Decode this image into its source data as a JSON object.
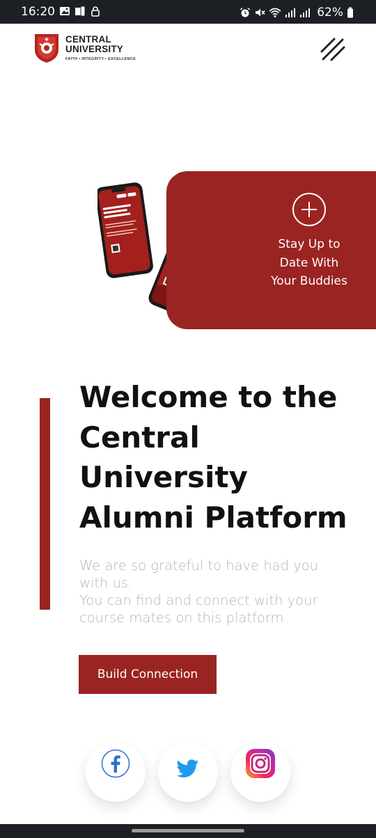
{
  "status_bar": {
    "time": "16:20",
    "battery": "62%"
  },
  "header": {
    "logo_name_line1": "CENTRAL",
    "logo_name_line2": "UNIVERSITY",
    "logo_motto": "FAITH • INTEGRITY • EXCELLENCE",
    "menu_icon": "menu-slashes-icon"
  },
  "hero": {
    "card_text": "Stay Up to Date With Your Buddies",
    "plus_icon": "plus-circle-icon",
    "phone_screen_text": "Welcome to the Central University Alumni Platform"
  },
  "welcome": {
    "title": "Welcome to the Central University Alumni Platform",
    "description_line1": "We are so grateful to have had you with us.",
    "description_line2": "You can find and connect with your course mates on this platform",
    "cta_label": "Build Connection"
  },
  "social": {
    "facebook_icon": "facebook-icon",
    "twitter_icon": "twitter-icon",
    "instagram_icon": "instagram-icon"
  },
  "colors": {
    "brand_red": "#9a2422",
    "status_bar": "#1c1f24",
    "description_gray": "#b5b5b5"
  }
}
